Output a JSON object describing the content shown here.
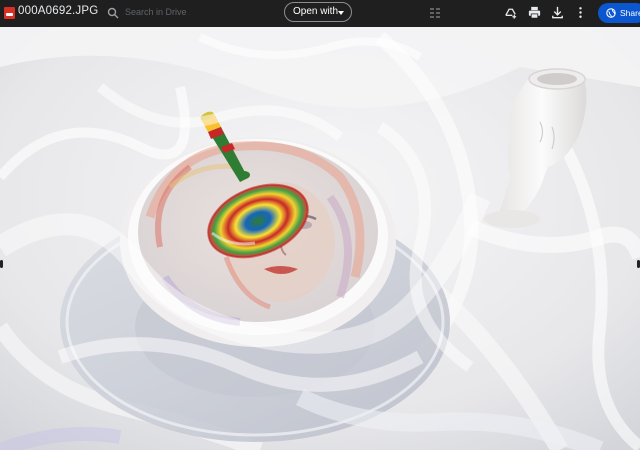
{
  "toolbar": {
    "file_name": "000A0692.JPG",
    "search_placeholder": "Search in Drive",
    "open_with_label": "Open with",
    "share_label": "Share",
    "icons": [
      "file-image-icon",
      "search-icon",
      "chevron-down-icon",
      "grid-icon",
      "add-to-drive-icon",
      "print-icon",
      "download-icon",
      "more-vert-icon",
      "globe-icon"
    ]
  },
  "viewer": {
    "image_alt": "Ceramic bowl with painted face and spinning top on glass plate, white goblet, white tulle fabric"
  },
  "colors": {
    "toolbar_bg": "#1f1f1f",
    "share_bg": "#0b57d0",
    "file_icon": "#d93025"
  }
}
